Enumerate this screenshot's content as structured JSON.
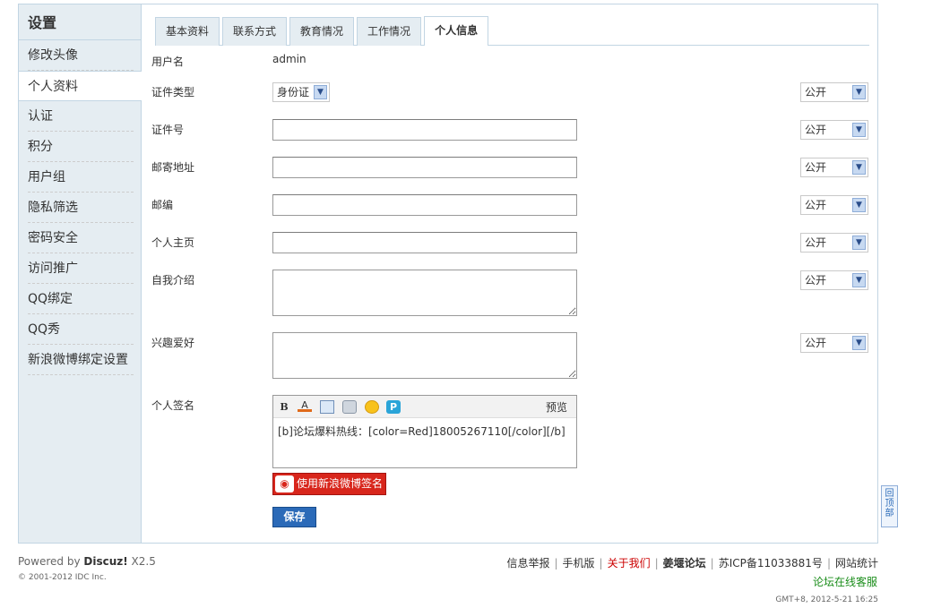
{
  "sidebar": {
    "title": "设置",
    "items": [
      {
        "label": "修改头像"
      },
      {
        "label": "个人资料"
      },
      {
        "label": "认证"
      },
      {
        "label": "积分"
      },
      {
        "label": "用户组"
      },
      {
        "label": "隐私筛选"
      },
      {
        "label": "密码安全"
      },
      {
        "label": "访问推广"
      },
      {
        "label": "QQ绑定"
      },
      {
        "label": "QQ秀"
      },
      {
        "label": "新浪微博绑定设置"
      }
    ]
  },
  "tabs": [
    {
      "label": "基本资料"
    },
    {
      "label": "联系方式"
    },
    {
      "label": "教育情况"
    },
    {
      "label": "工作情况"
    },
    {
      "label": "个人信息"
    }
  ],
  "form": {
    "username_label": "用户名",
    "username_value": "admin",
    "idtype_label": "证件类型",
    "idtype_value": "身份证",
    "idnumber_label": "证件号",
    "address_label": "邮寄地址",
    "zipcode_label": "邮编",
    "homepage_label": "个人主页",
    "bio_label": "自我介绍",
    "interest_label": "兴趣爱好",
    "signature_label": "个人签名",
    "privacy_value": "公开",
    "editor_bold": "B",
    "editor_color": "A",
    "editor_preview": "预览",
    "signature_content": "[b]论坛爆料热线：[color=Red]18005267110[/color][/b]",
    "weibo_button": "使用新浪微博签名",
    "save_button": "保存"
  },
  "footer": {
    "powered_prefix": "Powered by ",
    "powered_brand": "Discuz!",
    "powered_version": " X2.5",
    "copyright": "© 2001-2012 IDC Inc.",
    "links": [
      "信息举报",
      "手机版",
      "关于我们",
      "姜堰论坛",
      "苏ICP备11033881号",
      "网站统计"
    ],
    "service": "论坛在线客服",
    "gmt": "GMT+8, 2012-5-21 16:25"
  },
  "backtop": "回顶部",
  "colors": {
    "sidebar_bg": "#e5edf2",
    "border": "#c2d5e3",
    "save_button": "#2b6ab8",
    "weibo_button": "#d8261c",
    "link_red": "#cc0000",
    "service_green": "#1a8d1a"
  }
}
